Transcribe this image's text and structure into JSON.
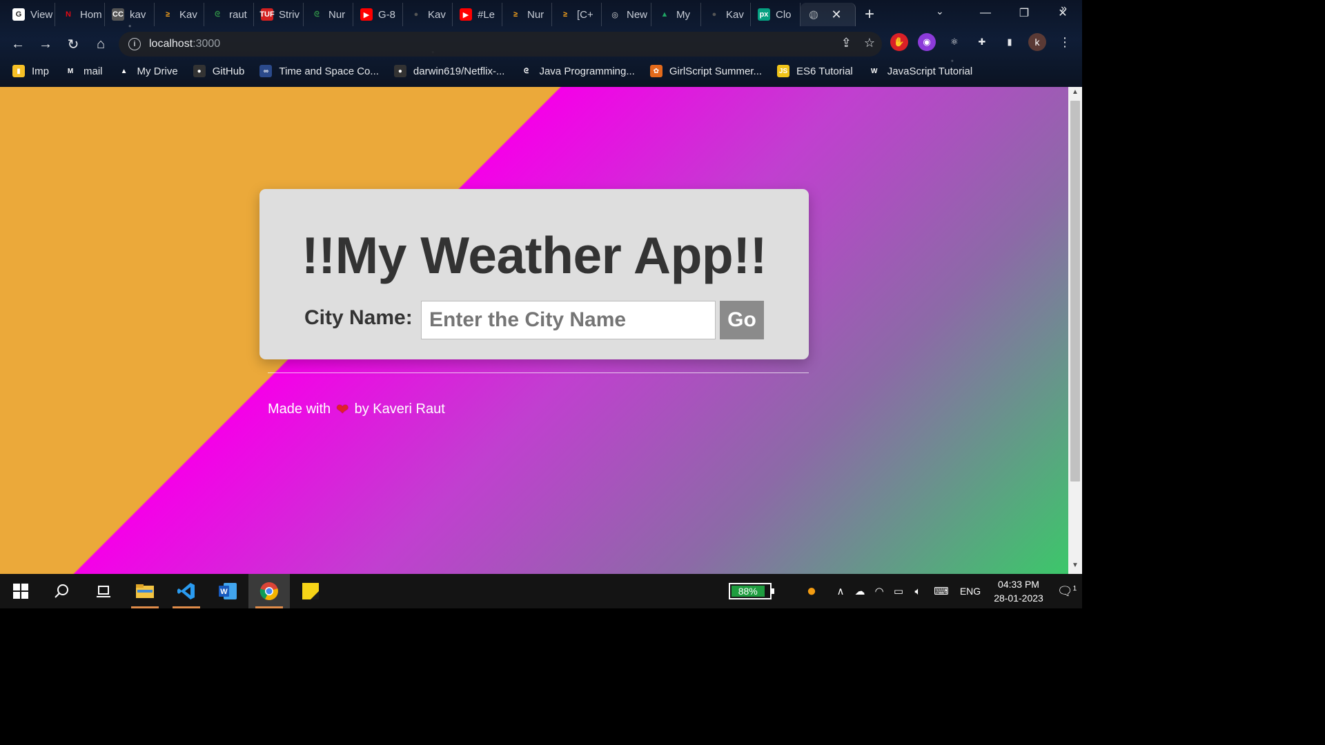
{
  "browser": {
    "tabs": [
      {
        "label": "View",
        "icon": "G",
        "color": "#222",
        "bg": "#fff"
      },
      {
        "label": "Hom",
        "icon": "N",
        "color": "#e50914",
        "bg": "transparent"
      },
      {
        "label": "kav",
        "icon": "CC",
        "color": "#fff",
        "bg": "#555"
      },
      {
        "label": "Kav",
        "icon": "≥",
        "color": "#f7a21b",
        "bg": "transparent"
      },
      {
        "label": "raut",
        "icon": "ᘓ",
        "color": "#2f8d46",
        "bg": "transparent"
      },
      {
        "label": "Striv",
        "icon": "TUF",
        "color": "#fff",
        "bg": "#d32020"
      },
      {
        "label": "Nur",
        "icon": "ᘓ",
        "color": "#2f8d46",
        "bg": "transparent"
      },
      {
        "label": "G-8",
        "icon": "▶",
        "color": "#fff",
        "bg": "#ff0000"
      },
      {
        "label": "Kav",
        "icon": "●",
        "color": "#555",
        "bg": "transparent"
      },
      {
        "label": "#Le",
        "icon": "▶",
        "color": "#fff",
        "bg": "#ff0000"
      },
      {
        "label": "Nur",
        "icon": "≥",
        "color": "#f7a21b",
        "bg": "transparent"
      },
      {
        "label": "[C+",
        "icon": "≥",
        "color": "#f7a21b",
        "bg": "transparent"
      },
      {
        "label": "New",
        "icon": "◎",
        "color": "#ddd",
        "bg": "transparent"
      },
      {
        "label": "My",
        "icon": "▲",
        "color": "#1fa463",
        "bg": "transparent"
      },
      {
        "label": "Kav",
        "icon": "●",
        "color": "#555",
        "bg": "transparent"
      },
      {
        "label": "Clo",
        "icon": "px",
        "color": "#fff",
        "bg": "#05a081"
      }
    ],
    "url_host": "localhost",
    "url_port": ":3000",
    "bookmarks": [
      {
        "label": "Imp",
        "icon": "▮",
        "bg": "#f6c026"
      },
      {
        "label": "mail",
        "icon": "M",
        "bg": "transparent"
      },
      {
        "label": "My Drive",
        "icon": "▲",
        "bg": "transparent"
      },
      {
        "label": "GitHub",
        "icon": "●",
        "bg": "#333"
      },
      {
        "label": "Time and Space Co...",
        "icon": "∞",
        "bg": "#2b4a8b"
      },
      {
        "label": "darwin619/Netflix-...",
        "icon": "●",
        "bg": "#333"
      },
      {
        "label": "Java Programming...",
        "icon": "ᘓ",
        "bg": "transparent"
      },
      {
        "label": "GirlScript Summer...",
        "icon": "✿",
        "bg": "#e36a1b"
      },
      {
        "label": "ES6 Tutorial",
        "icon": "JS",
        "bg": "#f0c419"
      },
      {
        "label": "JavaScript Tutorial",
        "icon": "W",
        "bg": "transparent"
      }
    ],
    "profile_initial": "k"
  },
  "app": {
    "title": "!!My Weather App!!",
    "city_label": "City Name:",
    "city_placeholder": "Enter the City Name",
    "city_value": "",
    "go_label": "Go",
    "footer_prefix": "Made with",
    "footer_suffix": "by Kaveri Raut"
  },
  "taskbar": {
    "battery_percent": "88%",
    "battery_level": 0.88,
    "language": "ENG",
    "time": "04:33 PM",
    "date": "28-01-2023",
    "notification_count": "1"
  }
}
